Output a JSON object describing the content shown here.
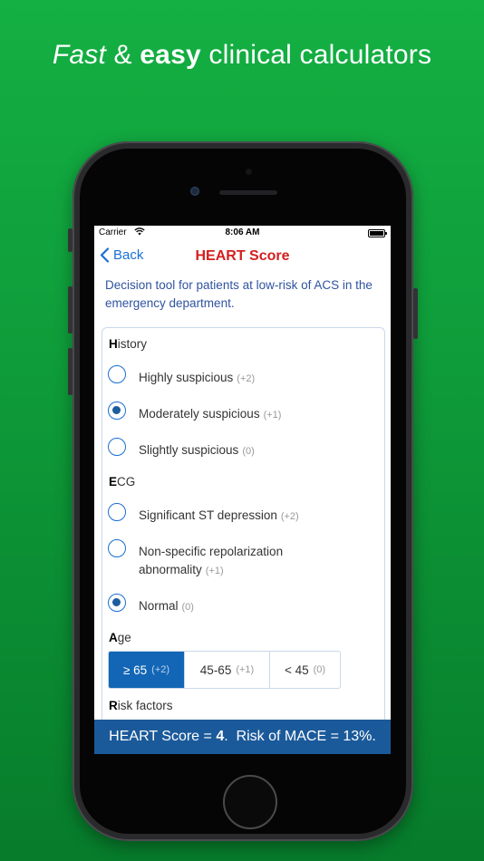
{
  "headline": {
    "fast": "Fast",
    "amp": "&",
    "easy": "easy",
    "rest": "clinical calculators"
  },
  "status_bar": {
    "carrier": "Carrier",
    "time": "8:06 AM"
  },
  "nav": {
    "back_label": "Back",
    "title": "HEART Score"
  },
  "description": "Decision tool for patients at low-risk of ACS in the emergency department.",
  "sections": {
    "history": {
      "initial": "H",
      "rest": "istory",
      "options": [
        {
          "label": "Highly suspicious",
          "points": "(+2)",
          "selected": false
        },
        {
          "label": "Moderately suspicious",
          "points": "(+1)",
          "selected": true
        },
        {
          "label": "Slightly suspicious",
          "points": "(0)",
          "selected": false
        }
      ]
    },
    "ecg": {
      "initial": "E",
      "rest": "CG",
      "options": [
        {
          "label": "Significant ST depression",
          "points": "(+2)",
          "selected": false
        },
        {
          "label": "Non-specific repolarization abnormality",
          "points": "(+1)",
          "selected": false
        },
        {
          "label": "Normal",
          "points": "(0)",
          "selected": true
        }
      ]
    },
    "age": {
      "initial": "A",
      "rest": "ge",
      "options": [
        {
          "label": "≥ 65",
          "points": "(+2)",
          "selected": true
        },
        {
          "label": "45-65",
          "points": "(+1)",
          "selected": false
        },
        {
          "label": "< 45",
          "points": "(0)",
          "selected": false
        }
      ]
    },
    "risk_factors": {
      "initial": "R",
      "rest": "isk factors"
    }
  },
  "result": {
    "prefix": "HEART Score =",
    "score": "4",
    "suffix": ".  Risk of MACE = 13%."
  },
  "colors": {
    "background": "#0e9a39",
    "title_red": "#d3201f",
    "accent_blue": "#1b6fd1",
    "selected_segment": "#1266b5",
    "result_bar": "#1b5a9a"
  },
  "icons": [
    "chevron-left-icon",
    "wifi-icon",
    "battery-icon"
  ]
}
